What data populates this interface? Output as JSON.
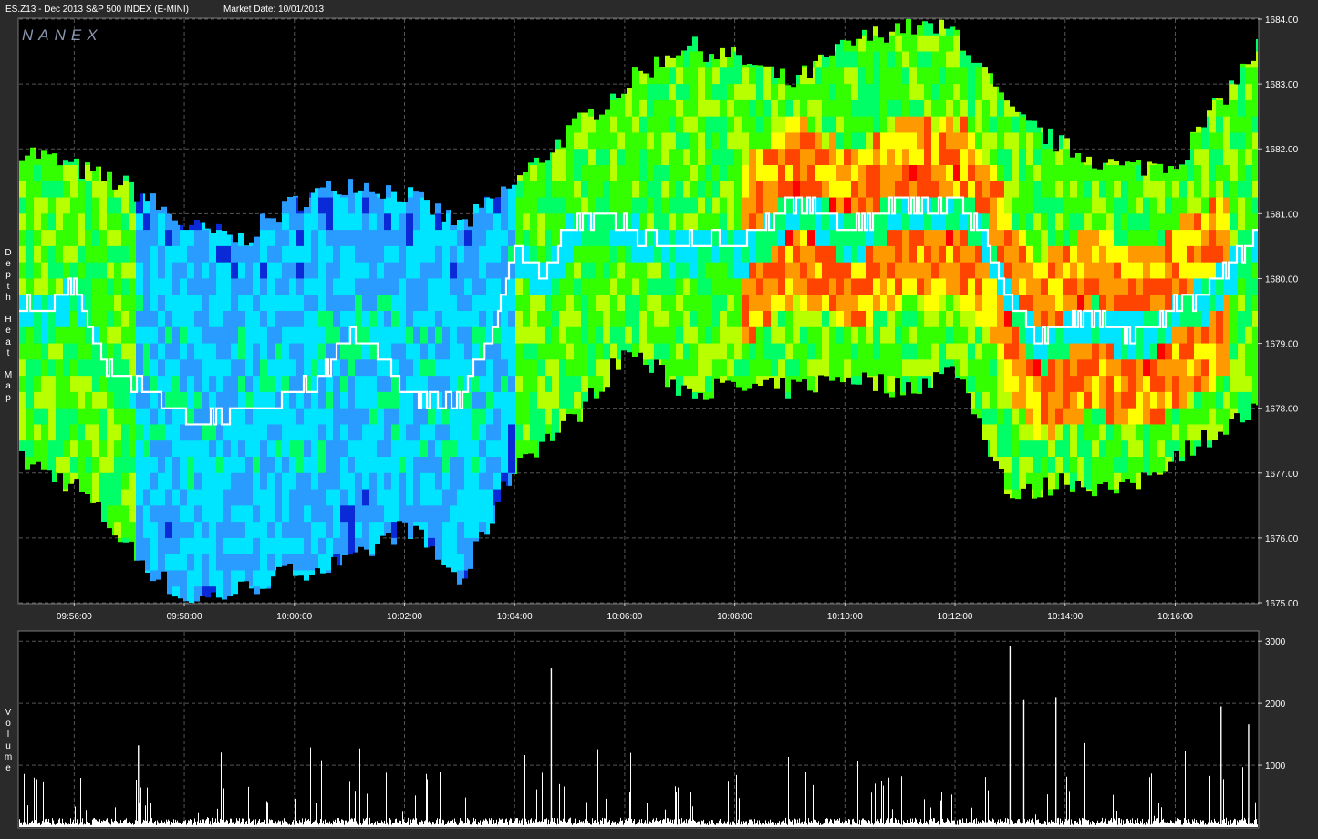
{
  "header": {
    "symbol_text": "ES.Z13 - Dec 2013 S&P 500 INDEX (E-MINI)",
    "date_text": "Market Date: 10/01/2013"
  },
  "logo": "NANEX",
  "side_labels": {
    "top": "Depth Heat Map",
    "bottom": "Volume"
  },
  "colors": {
    "background": "#000000",
    "frame": "#2a2a2a",
    "grid": "#555555",
    "price_line": "#ffffff",
    "volume": "#ffffff",
    "heat_scale": [
      "#0a2ad8",
      "#2a9bff",
      "#00e5ff",
      "#00ff66",
      "#33ff00",
      "#b8ff00",
      "#ffff00",
      "#ff9900",
      "#ff4400",
      "#ff0000"
    ]
  },
  "chart_data": [
    {
      "type": "heatmap",
      "title": "Depth Heat Map",
      "y_axis": {
        "min": 1675.0,
        "max": 1684.0,
        "ticks": [
          "1684.00",
          "1683.00",
          "1682.00",
          "1681.00",
          "1680.00",
          "1679.00",
          "1678.00",
          "1677.00",
          "1676.00",
          "1675.00"
        ]
      },
      "x_axis": {
        "start": "09:55:00",
        "end": "10:17:30",
        "ticks": [
          "09:56:00",
          "09:58:00",
          "10:00:00",
          "10:02:00",
          "10:04:00",
          "10:06:00",
          "10:08:00",
          "10:10:00",
          "10:12:00",
          "10:14:00",
          "10:16:00"
        ]
      },
      "grid": true,
      "depth_envelope": {
        "time_min": [
          0,
          1,
          2,
          3,
          4,
          5,
          6,
          7,
          8,
          9,
          10,
          11,
          12,
          13,
          14,
          15,
          16,
          17,
          18,
          19,
          20,
          21,
          22.5
        ],
        "upper": [
          1682.0,
          1681.7,
          1681.4,
          1680.8,
          1680.6,
          1681.2,
          1681.5,
          1681.3,
          1680.8,
          1681.5,
          1682.3,
          1683.0,
          1683.6,
          1683.4,
          1683.0,
          1683.6,
          1683.9,
          1683.8,
          1682.5,
          1682.0,
          1681.7,
          1681.8,
          1683.6
        ],
        "lower": [
          1677.2,
          1676.8,
          1675.8,
          1675.0,
          1675.2,
          1675.5,
          1675.6,
          1676.2,
          1675.3,
          1677.2,
          1677.8,
          1678.9,
          1678.3,
          1678.3,
          1678.3,
          1678.5,
          1678.3,
          1678.6,
          1676.6,
          1676.9,
          1676.7,
          1677.3,
          1678.0
        ]
      },
      "price_line": {
        "time_min": [
          0,
          0.5,
          1,
          1.5,
          2,
          2.5,
          3,
          3.5,
          4,
          4.5,
          5,
          5.5,
          6,
          6.5,
          7,
          7.5,
          8,
          8.5,
          9,
          9.5,
          10,
          10.5,
          11,
          11.5,
          12,
          12.5,
          13,
          13.5,
          14,
          14.5,
          15,
          15.5,
          16,
          16.5,
          17,
          17.5,
          18,
          18.5,
          19,
          19.5,
          20,
          20.5,
          21,
          21.5,
          22,
          22.5
        ],
        "price": [
          1679.6,
          1679.5,
          1679.9,
          1678.7,
          1678.3,
          1678.3,
          1677.8,
          1677.8,
          1678.0,
          1678.0,
          1678.2,
          1678.5,
          1679.1,
          1678.9,
          1678.2,
          1678.1,
          1678.1,
          1679.0,
          1680.4,
          1680.1,
          1680.8,
          1681.0,
          1680.8,
          1680.6,
          1680.5,
          1680.6,
          1680.5,
          1680.7,
          1681.2,
          1681.0,
          1680.7,
          1680.9,
          1681.2,
          1681.1,
          1681.2,
          1680.7,
          1679.6,
          1679.0,
          1679.3,
          1679.5,
          1679.2,
          1679.2,
          1679.6,
          1679.8,
          1680.2,
          1680.7
        ]
      }
    },
    {
      "type": "bar",
      "title": "Volume",
      "y_axis": {
        "min": 0,
        "max": 3000,
        "ticks": [
          "3000",
          "2000",
          "1000"
        ]
      },
      "grid": true,
      "notable_spikes": [
        {
          "time": "09:57:10",
          "value": 1320
        },
        {
          "time": "10:04:40",
          "value": 2560
        },
        {
          "time": "10:13:00",
          "value": 2930
        },
        {
          "time": "10:13:15",
          "value": 2050
        },
        {
          "time": "10:13:50",
          "value": 2100
        },
        {
          "time": "10:16:50",
          "value": 1950
        },
        {
          "time": "10:17:20",
          "value": 1660
        }
      ],
      "typical_range": [
        100,
        900
      ]
    }
  ]
}
